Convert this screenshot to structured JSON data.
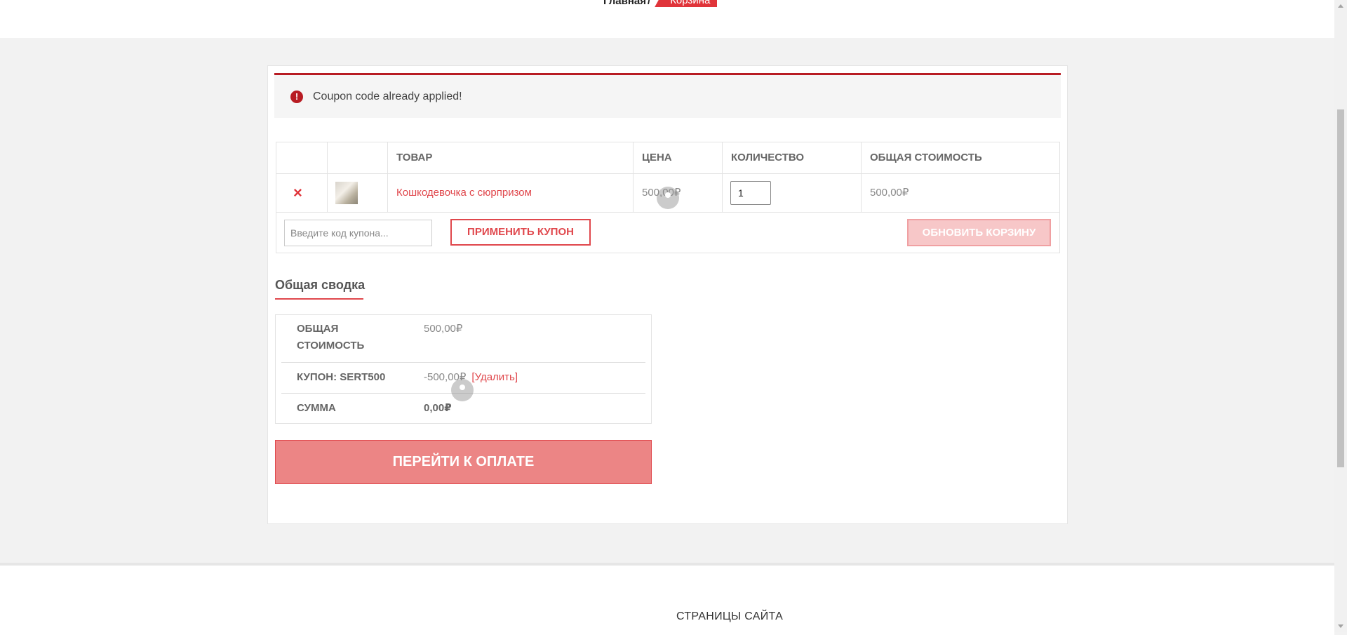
{
  "breadcrumb": {
    "home": "Главная",
    "separator": "/",
    "current": "Корзина"
  },
  "notice": {
    "icon": "alert-circle-icon",
    "text": "Coupon code already applied!"
  },
  "cart": {
    "headers": {
      "product": "ТОВАР",
      "price": "ЦЕНА",
      "quantity": "КОЛИЧЕСТВО",
      "subtotal": "ОБЩАЯ СТОИМОСТЬ"
    },
    "item": {
      "remove": "×",
      "name": "Кошкодевочка с сюрпризом",
      "price": "500,00₽",
      "quantity": "1",
      "subtotal": "500,00₽"
    },
    "coupon_placeholder": "Введите код купона...",
    "apply_label": "ПРИМЕНИТЬ КУПОН",
    "update_label": "ОБНОВИТЬ КОРЗИНУ"
  },
  "summary": {
    "title": "Общая сводка",
    "subtotal_label_1": "ОБЩАЯ",
    "subtotal_label_2": "СТОИМОСТЬ",
    "subtotal_value": "500,00₽",
    "coupon_label": "КУПОН: SERT500",
    "coupon_value": "-500,00₽",
    "coupon_remove": "[Удалить]",
    "total_label": "СУММА",
    "total_value": "0,00₽"
  },
  "checkout_label": "ПЕРЕЙТИ К ОПЛАТЕ",
  "footer": {
    "title": "СТРАНИЦЫ САЙТА"
  },
  "colors": {
    "accent": "#e0474c",
    "error": "#b81c23",
    "checkout_bg": "#ec8585"
  }
}
